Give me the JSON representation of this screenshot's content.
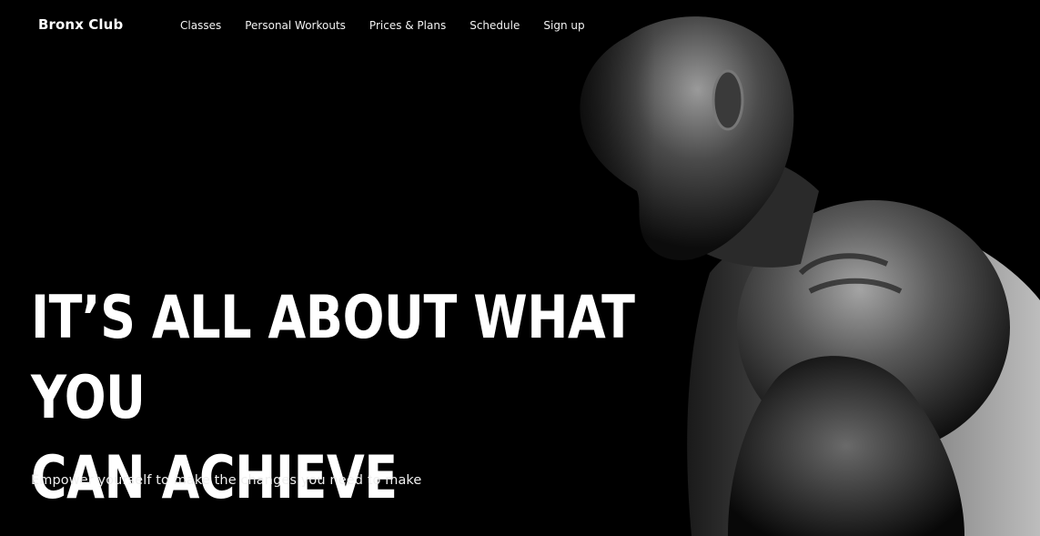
{
  "header": {
    "brand": "Bronx Club",
    "nav": [
      {
        "label": "Classes"
      },
      {
        "label": "Personal Workouts"
      },
      {
        "label": "Prices & Plans"
      },
      {
        "label": "Schedule"
      },
      {
        "label": "Sign up"
      }
    ]
  },
  "hero": {
    "headline_line1": "IT’S ALL ABOUT WHAT YOU",
    "headline_line2": "CAN ACHIEVE",
    "tagline": "Empower yourself to make the changes you need to make",
    "image": "black-and-white-athlete-photo",
    "background_color": "#000000",
    "text_color": "#ffffff"
  }
}
